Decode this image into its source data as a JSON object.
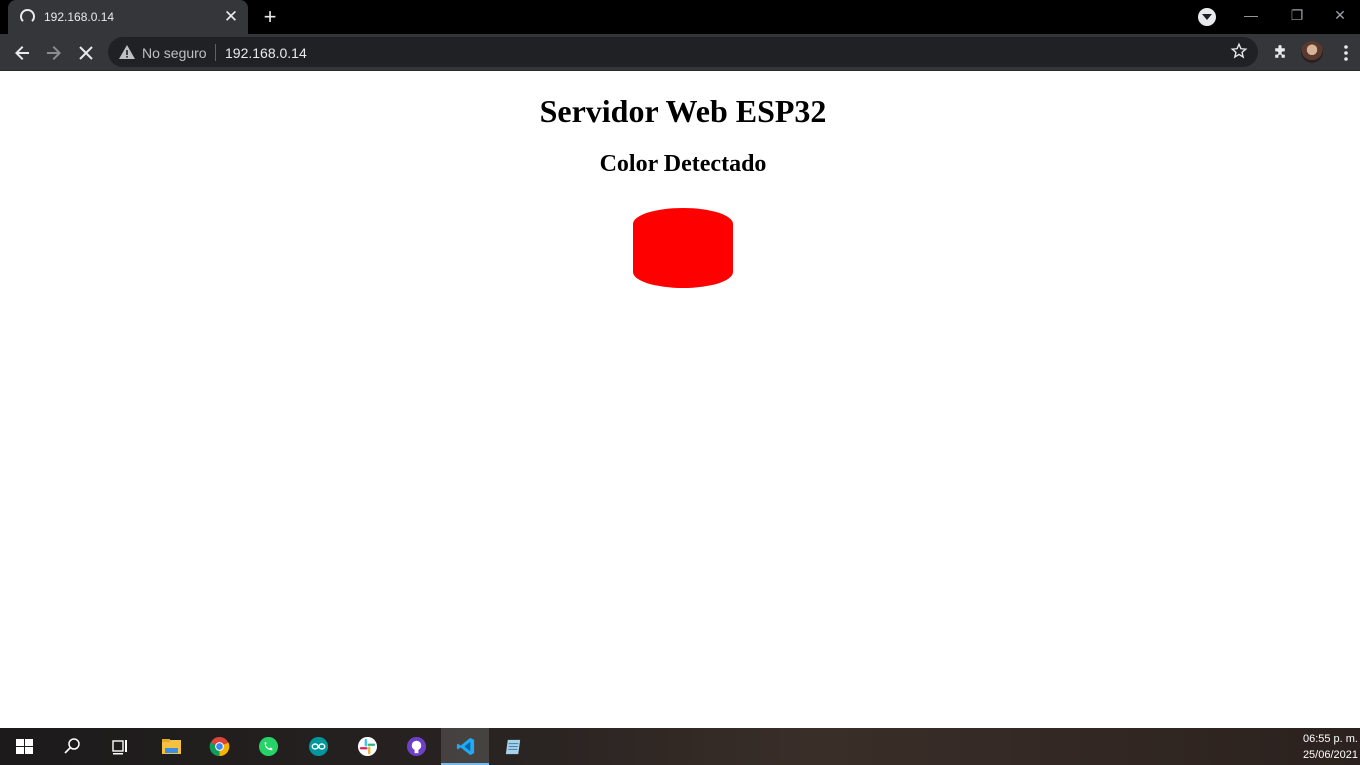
{
  "browser": {
    "tab_title": "192.168.0.14",
    "security_label": "No seguro",
    "url": "192.168.0.14"
  },
  "page": {
    "heading": "Servidor Web ESP32",
    "subheading": "Color Detectado",
    "detected_color": "#ff0000"
  },
  "taskbar": {
    "apps": [
      "windows-start",
      "search",
      "task-view",
      "file-explorer",
      "chrome",
      "whatsapp",
      "arduino",
      "slack",
      "github-desktop",
      "vscode",
      "notepad"
    ],
    "time": "06:55 p. m.",
    "date": "25/06/2021"
  },
  "colors": {
    "tabstrip": "#000000",
    "toolbar": "#35363a",
    "omnibox": "#202124"
  }
}
